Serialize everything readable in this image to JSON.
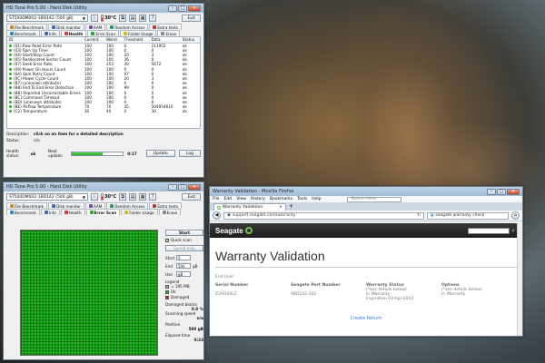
{
  "window_top": {
    "title": "HD Tune Pro 5.00 - Hard Disk Utility",
    "drive": "ST500DM002-1BD142 (500 gB)",
    "temperature": "30°C",
    "exit_label": "Exit",
    "tabs_row1": [
      "File Benchmark",
      "Disk monitor",
      "AAM",
      "Random Access",
      "Extra tests"
    ],
    "tabs_row2": [
      "Benchmark",
      "Info",
      "Health",
      "Error Scan",
      "Folder Usage",
      "Erase"
    ],
    "active_tab": "Health",
    "columns": [
      "ID",
      "Current",
      "Worst",
      "Threshold",
      "Data",
      "Status"
    ],
    "rows": [
      [
        "(01) Raw Read Error Rate",
        "100",
        "100",
        "6",
        "211952",
        "ok"
      ],
      [
        "(03) Spin Up Time",
        "100",
        "100",
        "0",
        "0",
        "ok"
      ],
      [
        "(04) Start/Stop Count",
        "100",
        "100",
        "20",
        "3",
        "ok"
      ],
      [
        "(05) Reallocated Sector Count",
        "100",
        "100",
        "36",
        "0",
        "ok"
      ],
      [
        "(07) Seek Error Rate",
        "100",
        "253",
        "30",
        "5672",
        "ok"
      ],
      [
        "(09) Power On Hours Count",
        "100",
        "100",
        "0",
        "0",
        "ok"
      ],
      [
        "(0A) Spin Retry Count",
        "100",
        "100",
        "97",
        "0",
        "ok"
      ],
      [
        "(0C) Power Cycle Count",
        "100",
        "100",
        "20",
        "3",
        "ok"
      ],
      [
        "(B7) (unknown attribute)",
        "100",
        "100",
        "0",
        "0",
        "ok"
      ],
      [
        "(B8) End To End Error Detection",
        "100",
        "100",
        "99",
        "0",
        "ok"
      ],
      [
        "(BB) Reported Uncorrectable Errors",
        "100",
        "100",
        "0",
        "0",
        "ok"
      ],
      [
        "(BC) Command Timeout",
        "100",
        "100",
        "0",
        "0",
        "ok"
      ],
      [
        "(BD) (unknown attribute)",
        "100",
        "100",
        "0",
        "0",
        "ok"
      ],
      [
        "(BE) Airflow Temperature",
        "70",
        "70",
        "45",
        "504954610",
        "ok"
      ],
      [
        "(C2) Temperature",
        "30",
        "40",
        "0",
        "30",
        "ok"
      ]
    ],
    "description_label": "Description:",
    "description_value": "click on an item for a detailed description",
    "status_label": "Status:",
    "status_value": "n/a",
    "health_status_label": "Health status:",
    "health_status_value": "ok",
    "next_update_label": "Next update:",
    "next_update_progress": 0.6,
    "next_update_time": "0:17",
    "update_button": "Update",
    "log_button": "Log"
  },
  "window_scan": {
    "title": "HD Tune Pro 5.00 - Hard Disk Utility",
    "drive": "ST500DM002-1BD142 (500 gB)",
    "temperature": "30°C",
    "exit_label": "Exit",
    "tabs_row1": [
      "File Benchmark",
      "Disk monitor",
      "AAM",
      "Random Access",
      "Extra tests"
    ],
    "tabs_row2": [
      "Benchmark",
      "Info",
      "Health",
      "Error Scan",
      "Folder Usage",
      "Erase"
    ],
    "active_tab": "Error Scan",
    "start_button": "Start",
    "quick_scan_label": "Quick scan",
    "speed_map_button": "Speed map",
    "start_label": "Start",
    "start_value": "0",
    "end_label": "End",
    "end_value": "500",
    "end_unit": "gB",
    "use_label": "Use",
    "use_value": "gB",
    "legend_label": "Legend",
    "legend_block": "= 195 MB",
    "legend_ok": "Ok",
    "legend_damaged": "Damaged",
    "damaged_blocks_label": "Damaged blocks",
    "damaged_blocks_value": "0.0 %",
    "scanning_speed_label": "Scanning speed",
    "scanning_speed_value": "n/a",
    "position_label": "Position",
    "position_value": "500 gB",
    "elapsed_label": "Elapsed time",
    "elapsed_value": "0:33",
    "colors": {
      "ok": "#22bb22",
      "damaged": "#cc2222"
    }
  },
  "firefox": {
    "title": "Warranty Validation - Mozilla Firefox",
    "menu": [
      "File",
      "Edit",
      "View",
      "History",
      "Bookmarks",
      "Tools",
      "Help"
    ],
    "tab_label": "Warranty Validation",
    "url": "support.seagate.com/warranty",
    "search_placeholder": "seagate warranty check",
    "site_search_placeholder": "Search Here",
    "brand": "Seagate",
    "heading": "Warranty Validation",
    "end_user_label": "End User",
    "col_headers": [
      "Serial Number",
      "Seagate Part Number",
      "Warranty Status",
      "Options"
    ],
    "col_sub": [
      "",
      "",
      "(*see details below)",
      "(*see details below)"
    ],
    "values": [
      "Z2AGV0LZ",
      "9BD142-302",
      "In Warranty",
      "In Warranty"
    ],
    "expiration": "Expiration 03-Apr-2014",
    "create_return": "Create Return",
    "accent": "#6cc24a"
  }
}
